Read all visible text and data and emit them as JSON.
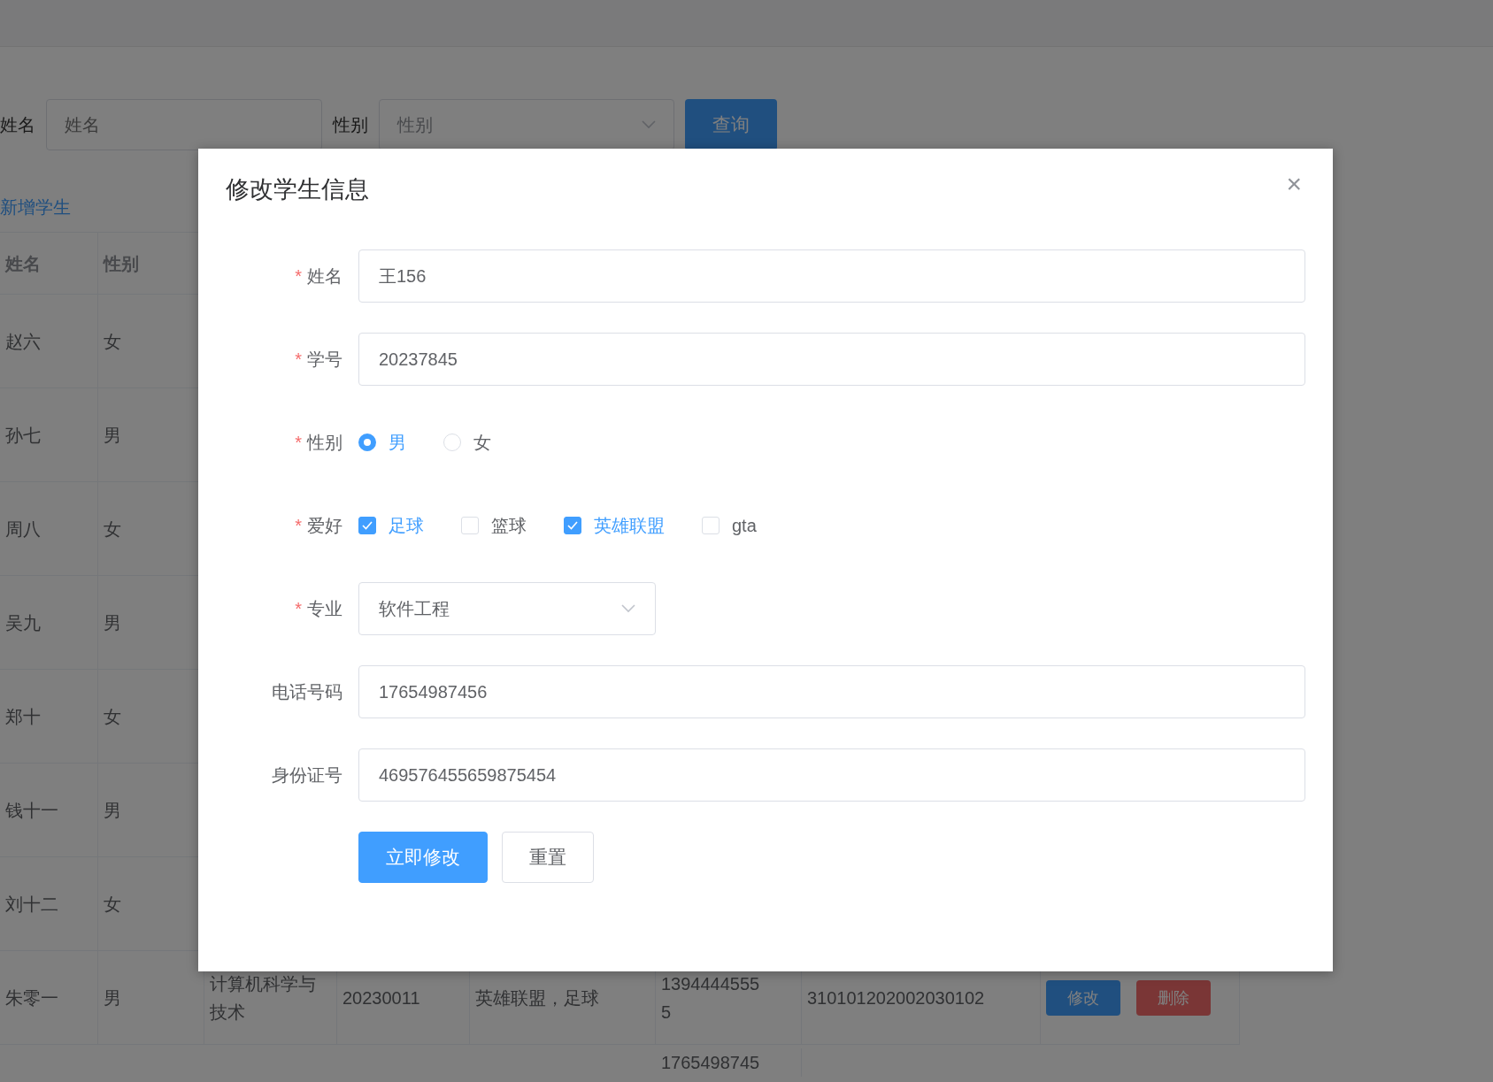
{
  "search": {
    "name_label": "姓名",
    "name_placeholder": "姓名",
    "gender_label": "性别",
    "gender_placeholder": "性别",
    "button": "查询"
  },
  "add_link": "新增学生",
  "table": {
    "columns": [
      "姓名",
      "性别"
    ],
    "rows": [
      {
        "column_1": "赵六",
        "column_2": "女"
      },
      {
        "column_1": "孙七",
        "column_2": "男"
      },
      {
        "column_1": "周八",
        "column_2": "女"
      },
      {
        "column_1": "吴九",
        "column_2": "男"
      },
      {
        "column_1": "郑十",
        "column_2": "女"
      },
      {
        "column_1": "钱十一",
        "column_2": "男"
      },
      {
        "column_1": "刘十二",
        "column_2": "女"
      },
      {
        "column_1": "朱零一",
        "column_2": "男",
        "column_3": "计算机科学与技术",
        "column_4": "20230011",
        "column_5": "英雄联盟，足球",
        "column_6": "13944445555",
        "column_7": "310101202002030102",
        "actions": [
          {
            "label": "修改",
            "kind": "edit"
          },
          {
            "label": "删除",
            "kind": "delete"
          }
        ]
      },
      {
        "column_6": "1765498745"
      }
    ]
  },
  "dialog": {
    "title": "修改学生信息",
    "close": "×",
    "fields": [
      {
        "kind": "input",
        "label": "姓名",
        "required_mark": "*",
        "value": "王156"
      },
      {
        "kind": "input",
        "label": "学号",
        "required_mark": "*",
        "value": "20237845"
      },
      {
        "kind": "radio",
        "label": "性别",
        "required_mark": "*",
        "options": [
          {
            "label": "男",
            "selected": true
          },
          {
            "label": "女",
            "selected": false
          }
        ]
      },
      {
        "kind": "checkbox",
        "label": "爱好",
        "required_mark": "*",
        "options": [
          {
            "label": "足球",
            "checked": true
          },
          {
            "label": "篮球",
            "checked": false
          },
          {
            "label": "英雄联盟",
            "checked": true
          },
          {
            "label": "gta",
            "checked": false
          }
        ]
      },
      {
        "kind": "select",
        "label": "专业",
        "required_mark": "*",
        "value": "软件工程"
      },
      {
        "kind": "input",
        "label": "电话号码",
        "value": "17654987456"
      },
      {
        "kind": "input",
        "label": "身份证号",
        "value": "469576455659875454"
      }
    ],
    "buttons": [
      {
        "label": "立即修改",
        "primary": true
      },
      {
        "label": "重置",
        "primary": false
      }
    ]
  }
}
